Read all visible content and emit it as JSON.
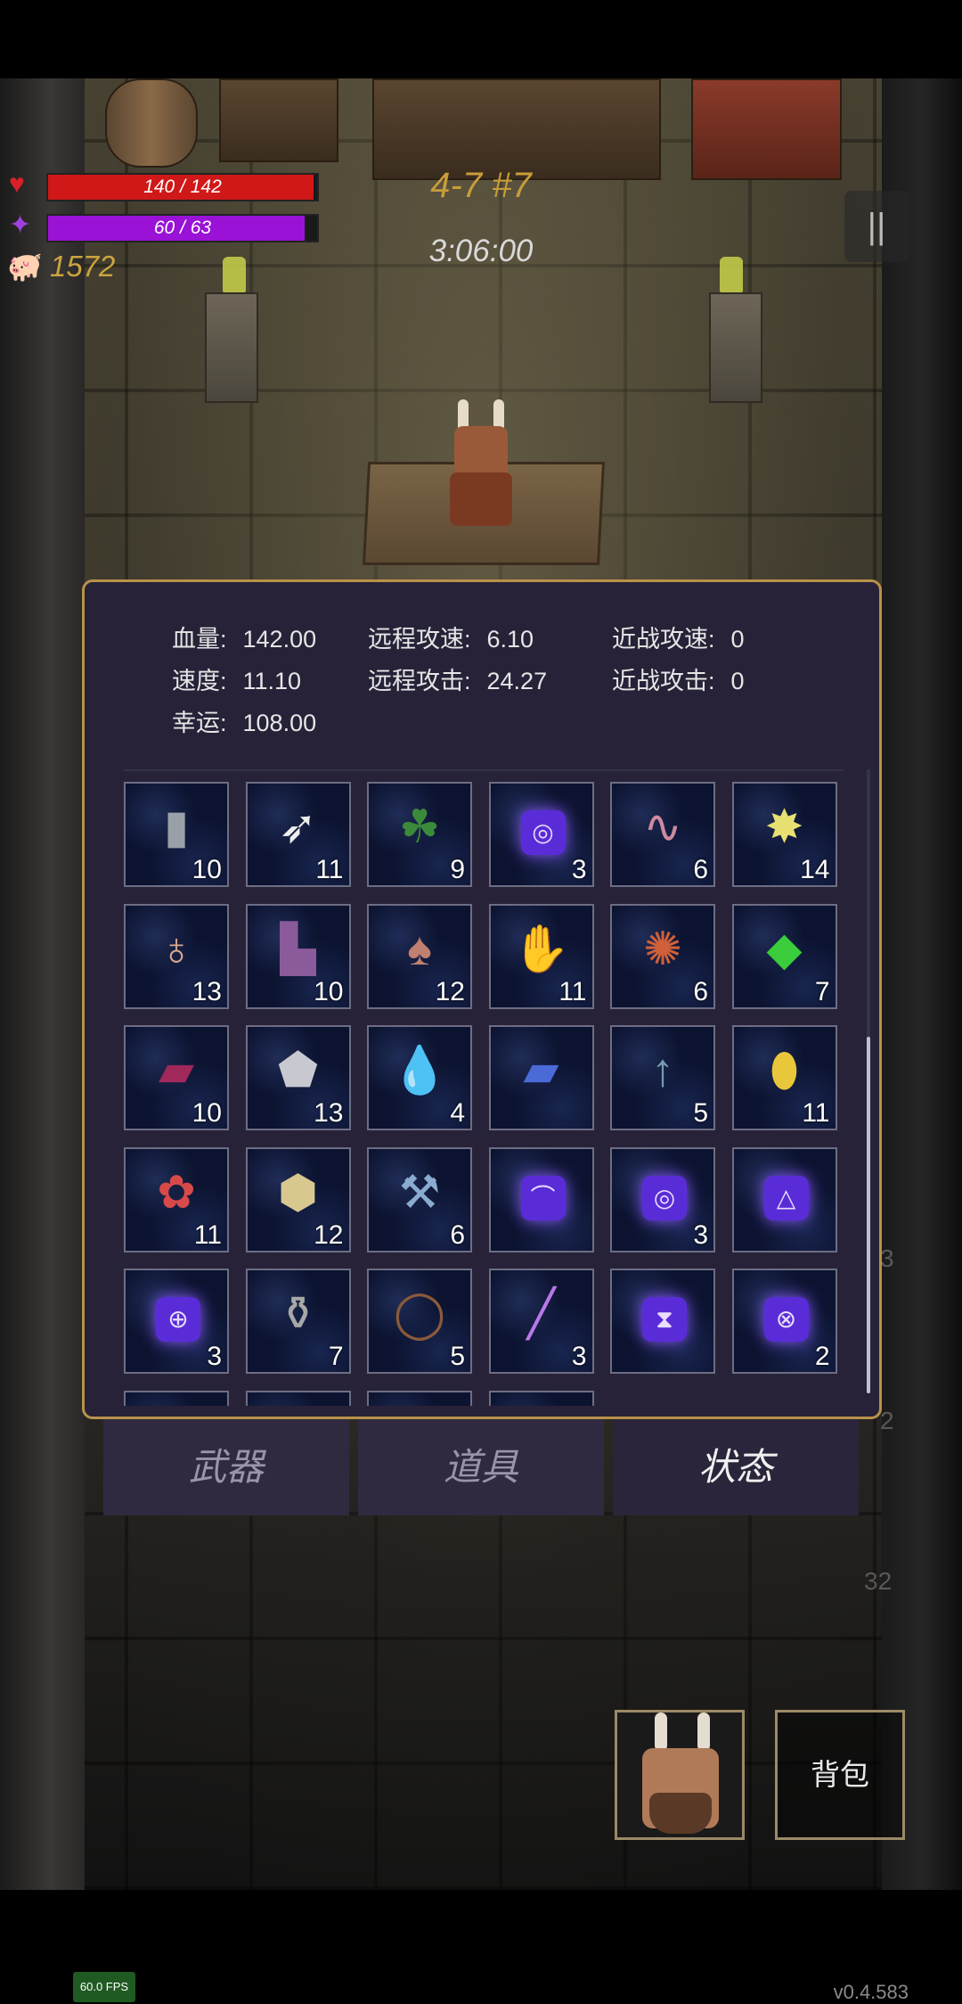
{
  "hud": {
    "hp": {
      "text": "140 / 142",
      "fraction": 0.986,
      "color": "#d01818"
    },
    "mp": {
      "text": "60 / 63",
      "fraction": 0.952,
      "color": "#9a12d6"
    },
    "gold": "1572",
    "level": "4-7 #7",
    "timer": "3:06:00"
  },
  "stats": [
    {
      "key": "血量:",
      "value": "142.00"
    },
    {
      "key": "远程攻速:",
      "value": "6.10"
    },
    {
      "key": "近战攻速:",
      "value": "0"
    },
    {
      "key": "速度:",
      "value": "11.10"
    },
    {
      "key": "远程攻击:",
      "value": "24.27"
    },
    {
      "key": "近战攻击:",
      "value": "0"
    },
    {
      "key": "幸运:",
      "value": "108.00"
    }
  ],
  "items": [
    {
      "icon": "tombstone",
      "glyph": "▮",
      "color": "#9aa0a8",
      "count": "10"
    },
    {
      "icon": "feather",
      "glyph": "➶",
      "color": "#eeeeee",
      "count": "11"
    },
    {
      "icon": "clover",
      "glyph": "☘",
      "color": "#3a8a3a",
      "count": "9"
    },
    {
      "icon": "spiral-rune",
      "glyph": "◎",
      "rune": true,
      "count": "3"
    },
    {
      "icon": "worm",
      "glyph": "∿",
      "color": "#d08aa0",
      "count": "6"
    },
    {
      "icon": "star-crystal",
      "glyph": "✸",
      "color": "#e8e070",
      "count": "14"
    },
    {
      "icon": "sack",
      "glyph": "♁",
      "color": "#d8a890",
      "count": "13"
    },
    {
      "icon": "boots",
      "glyph": "▙",
      "color": "#8a5a9a",
      "count": "10"
    },
    {
      "icon": "mushroom",
      "glyph": "♠",
      "color": "#c08070",
      "count": "12"
    },
    {
      "icon": "gloves",
      "glyph": "✋",
      "color": "#a04a3a",
      "count": "11"
    },
    {
      "icon": "spiky-skull",
      "glyph": "✺",
      "color": "#d0603a",
      "count": "6"
    },
    {
      "icon": "green-crystal",
      "glyph": "◆",
      "color": "#3acc3a",
      "count": "7"
    },
    {
      "icon": "red-book",
      "glyph": "▰",
      "color": "#a0285a",
      "count": "10"
    },
    {
      "icon": "silver-ore",
      "glyph": "⬟",
      "color": "#c8c8d0",
      "count": "13"
    },
    {
      "icon": "water-drop",
      "glyph": "💧",
      "color": "#3a8ad8",
      "count": "4"
    },
    {
      "icon": "blue-spellbook",
      "glyph": "▰",
      "color": "#4a6ad8",
      "count": ""
    },
    {
      "icon": "arrow-up",
      "glyph": "↑",
      "color": "#7a9ab0",
      "count": "5"
    },
    {
      "icon": "yellow-crystal",
      "glyph": "⬮",
      "color": "#e8c83a",
      "count": "11"
    },
    {
      "icon": "red-flower",
      "glyph": "✿",
      "color": "#d84a4a",
      "count": "11"
    },
    {
      "icon": "ore-chunks",
      "glyph": "⬢",
      "color": "#d8c890",
      "count": "12"
    },
    {
      "icon": "blue-stone-hammer",
      "glyph": "⚒",
      "color": "#8aaad0",
      "count": "6"
    },
    {
      "icon": "curve-rune",
      "glyph": "⌒",
      "rune": true,
      "count": ""
    },
    {
      "icon": "swirl-rune",
      "glyph": "◎",
      "rune": true,
      "count": "3"
    },
    {
      "icon": "triangle-rune",
      "glyph": "△",
      "rune": true,
      "count": ""
    },
    {
      "icon": "cross-rune",
      "glyph": "⊕",
      "rune": true,
      "count": "3"
    },
    {
      "icon": "potion-bottle",
      "glyph": "⚱",
      "color": "#a8a8a8",
      "count": "7"
    },
    {
      "icon": "thorn-ring",
      "glyph": "◯",
      "color": "#8a5a3a",
      "count": "5"
    },
    {
      "icon": "purple-wand",
      "glyph": "╱",
      "color": "#b878e8",
      "count": "3"
    },
    {
      "icon": "hourglass-rune",
      "glyph": "⧗",
      "rune": true,
      "count": ""
    },
    {
      "icon": "x-rune",
      "glyph": "⊗",
      "rune": true,
      "count": "2"
    }
  ],
  "tabs": [
    {
      "label": "武器",
      "active": false
    },
    {
      "label": "道具",
      "active": false
    },
    {
      "label": "状态",
      "active": true
    }
  ],
  "bag_label": "背包",
  "side_numbers": [
    "3",
    "2",
    "32"
  ],
  "fps": "60.0 FPS",
  "version": "v0.4.583"
}
